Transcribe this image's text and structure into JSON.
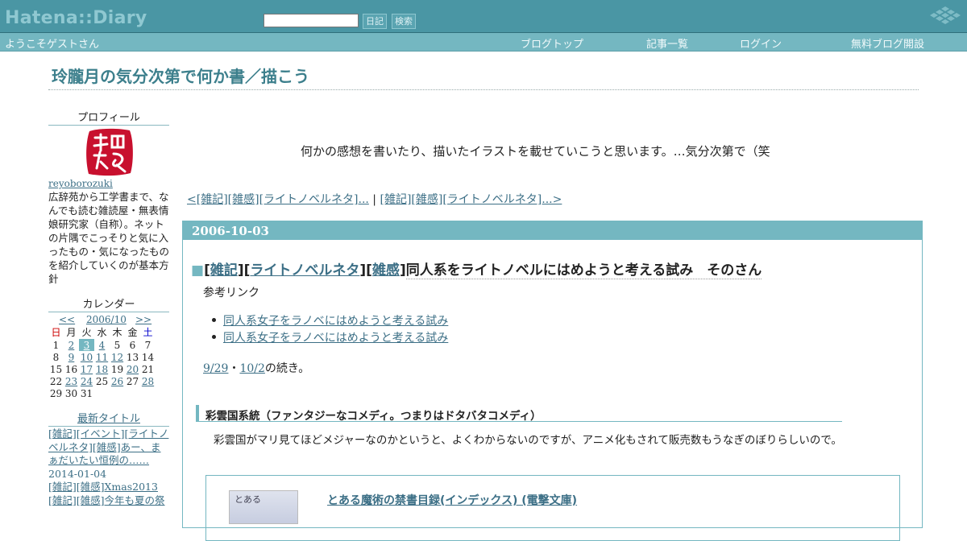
{
  "header": {
    "logo": "Hatena::Diary",
    "search_value": "",
    "diary_button": "日記",
    "search_button": "検索"
  },
  "nav": {
    "welcome": "ようこそゲストさん",
    "links": [
      "ブログトップ",
      "記事一覧",
      "ログイン",
      "無料ブログ開設"
    ]
  },
  "blog": {
    "title": "玲朧月の気分次第で何か書／描こう",
    "intro": "何かの感想を書いたり、描いたイラストを載せていこうと思います。…気分次第で（笑"
  },
  "sidebar": {
    "profile_heading": "プロフィール",
    "username": "reyoborozuki",
    "profile_text": "広辞苑から工学書まで、なんでも読む雑読屋・無表情娘研究家（自称）。ネットの片隅でこっそりと気に入ったもの・気になったものを紹介していくのが基本方針",
    "calendar_heading": "カレンダー",
    "calendar_prev": "<<",
    "calendar_month": "2006/10",
    "calendar_next": ">>",
    "weekdays": [
      "日",
      "月",
      "火",
      "水",
      "木",
      "金",
      "土"
    ],
    "calendar_rows": [
      [
        "1",
        "2",
        "3",
        "4",
        "5",
        "6",
        "7"
      ],
      [
        "8",
        "9",
        "10",
        "11",
        "12",
        "13",
        "14"
      ],
      [
        "15",
        "16",
        "17",
        "18",
        "19",
        "20",
        "21"
      ],
      [
        "22",
        "23",
        "24",
        "25",
        "26",
        "27",
        "28"
      ],
      [
        "29",
        "30",
        "31",
        "",
        "",
        "",
        ""
      ]
    ],
    "linked_days": [
      "2",
      "3",
      "4",
      "9",
      "10",
      "11",
      "12",
      "17",
      "18",
      "20",
      "23",
      "24",
      "26",
      "28"
    ],
    "today": "3",
    "recent_heading": "最新タイトル",
    "recent": [
      "[雑記][イベント][ライトノベルネタ][雑感]あー、まぁだいたい恒例の……",
      "2014-01-04",
      "[雑記][雑感]Xmas2013",
      "[雑記][雑感]今年も夏の祭"
    ]
  },
  "main": {
    "pager_prev": "<[雑記][雑感][ライトノベルネタ]...",
    "pager_sep": " | ",
    "pager_next": "[雑記][雑感][ライトノベルネタ]...>",
    "entry": {
      "date": "2006-10-03",
      "square": "■",
      "tags": [
        "雑記",
        "ライトノベルネタ",
        "雑感"
      ],
      "title": "同人系をライトノベルにはめようと考える試み　そのさん",
      "ref_label": "参考リンク",
      "refs": [
        "同人系女子をラノベにはめようと考える試み",
        "同人系女子をラノベにはめようと考える試み"
      ],
      "cont_link1": "9/29",
      "cont_sep": "・",
      "cont_link2": "10/2",
      "cont_suffix": "の続き。",
      "subheading": "彩雲国系統（ファンタジーなコメディ。つまりはドタバタコメディ）",
      "subtext": "彩雲国がマリ見てほどメジャーなのかというと、よくわからないのですが、アニメ化もされて販売数もうなぎのぼりらしいので。",
      "book_cover_text": "とある",
      "book_link": "とある魔術の禁書目録(インデックス) (電撃文庫)"
    }
  },
  "colors": {
    "header_bg": "#4a96a4",
    "nav_bg": "#74b7c1",
    "accent": "#74b7c1",
    "title_color": "#3c7f8c",
    "link": "#3c6f86",
    "seal_red": "#c8102e"
  },
  "icons": {
    "logo_mark": "cube-grid-icon",
    "profile_image": "red-seal-stamp"
  }
}
